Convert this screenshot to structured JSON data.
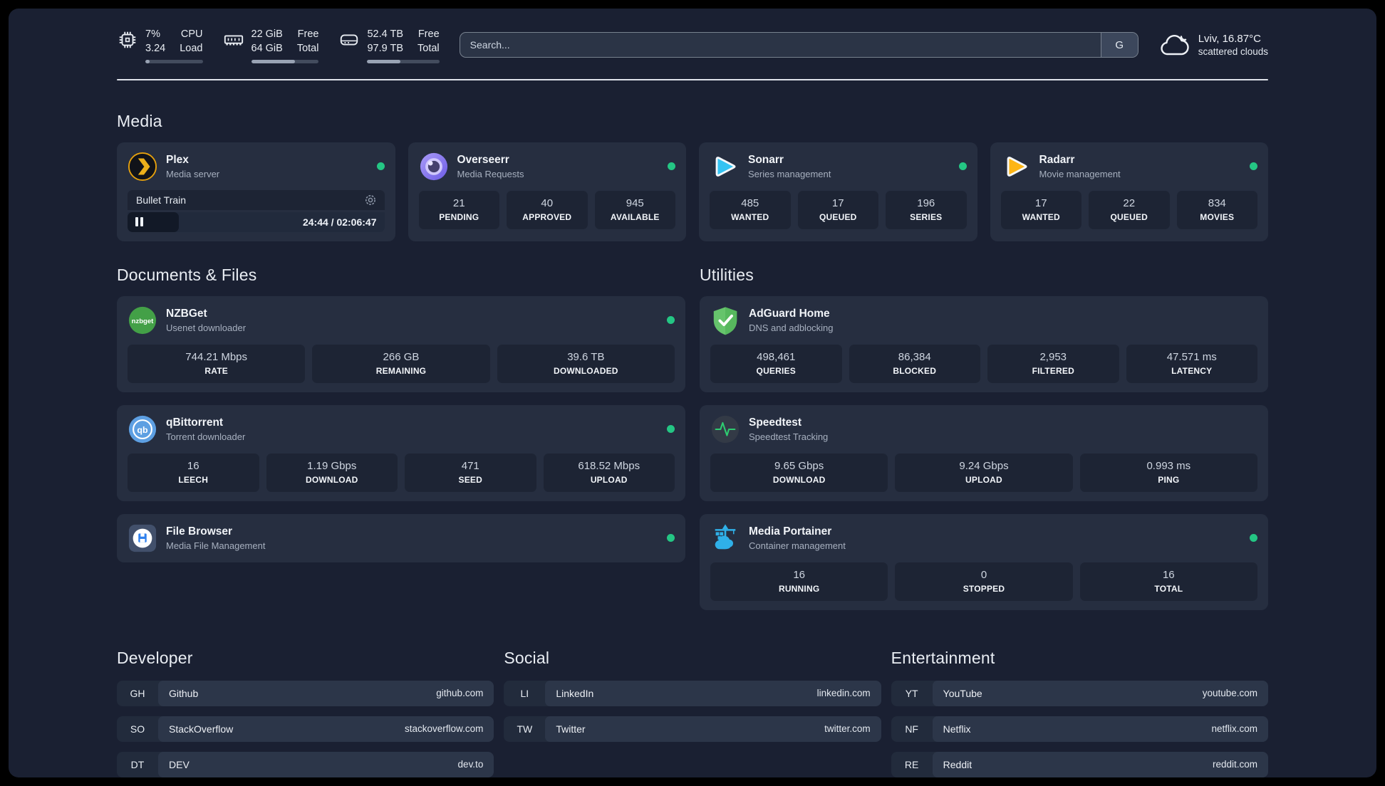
{
  "colors": {
    "status_online": "#24c684",
    "plex_accent": "#e5a00d",
    "progress_fill": "#99a3b4"
  },
  "header": {
    "cpu": {
      "value_top": "7%",
      "value_bottom": "3.24",
      "label_top": "CPU",
      "label_bottom": "Load",
      "progress_pct": 7
    },
    "ram": {
      "value_top": "22 GiB",
      "value_bottom": "64 GiB",
      "label_top": "Free",
      "label_bottom": "Total",
      "progress_pct": 65
    },
    "disk": {
      "value_top": "52.4 TB",
      "value_bottom": "97.9 TB",
      "label_top": "Free",
      "label_bottom": "Total",
      "progress_pct": 46
    },
    "search": {
      "placeholder": "Search...",
      "engine_button": "G"
    },
    "weather": {
      "location_temp": "Lviv, 16.87°C",
      "condition": "scattered clouds"
    }
  },
  "sections": {
    "media": {
      "title": "Media",
      "plex": {
        "name": "Plex",
        "subtitle": "Media server",
        "player": {
          "track": "Bullet Train",
          "time": "24:44 / 02:06:47",
          "progress_pct": 20
        }
      },
      "overseerr": {
        "name": "Overseerr",
        "subtitle": "Media Requests",
        "stats": [
          {
            "value": "21",
            "label": "PENDING"
          },
          {
            "value": "40",
            "label": "APPROVED"
          },
          {
            "value": "945",
            "label": "AVAILABLE"
          }
        ]
      },
      "sonarr": {
        "name": "Sonarr",
        "subtitle": "Series management",
        "stats": [
          {
            "value": "485",
            "label": "WANTED"
          },
          {
            "value": "17",
            "label": "QUEUED"
          },
          {
            "value": "196",
            "label": "SERIES"
          }
        ]
      },
      "radarr": {
        "name": "Radarr",
        "subtitle": "Movie management",
        "stats": [
          {
            "value": "17",
            "label": "WANTED"
          },
          {
            "value": "22",
            "label": "QUEUED"
          },
          {
            "value": "834",
            "label": "MOVIES"
          }
        ]
      }
    },
    "documents": {
      "title": "Documents & Files",
      "nzbget": {
        "name": "NZBGet",
        "subtitle": "Usenet downloader",
        "stats": [
          {
            "value": "744.21 Mbps",
            "label": "RATE"
          },
          {
            "value": "266 GB",
            "label": "REMAINING"
          },
          {
            "value": "39.6 TB",
            "label": "DOWNLOADED"
          }
        ]
      },
      "qbittorrent": {
        "name": "qBittorrent",
        "subtitle": "Torrent downloader",
        "stats": [
          {
            "value": "16",
            "label": "LEECH"
          },
          {
            "value": "1.19 Gbps",
            "label": "DOWNLOAD"
          },
          {
            "value": "471",
            "label": "SEED"
          },
          {
            "value": "618.52 Mbps",
            "label": "UPLOAD"
          }
        ]
      },
      "filebrowser": {
        "name": "File Browser",
        "subtitle": "Media File Management"
      }
    },
    "utilities": {
      "title": "Utilities",
      "adguard": {
        "name": "AdGuard Home",
        "subtitle": "DNS and adblocking",
        "stats": [
          {
            "value": "498,461",
            "label": "QUERIES"
          },
          {
            "value": "86,384",
            "label": "BLOCKED"
          },
          {
            "value": "2,953",
            "label": "FILTERED"
          },
          {
            "value": "47.571 ms",
            "label": "LATENCY"
          }
        ]
      },
      "speedtest": {
        "name": "Speedtest",
        "subtitle": "Speedtest Tracking",
        "stats": [
          {
            "value": "9.65 Gbps",
            "label": "DOWNLOAD"
          },
          {
            "value": "9.24 Gbps",
            "label": "UPLOAD"
          },
          {
            "value": "0.993 ms",
            "label": "PING"
          }
        ]
      },
      "portainer": {
        "name": "Media Portainer",
        "subtitle": "Container management",
        "stats": [
          {
            "value": "16",
            "label": "RUNNING"
          },
          {
            "value": "0",
            "label": "STOPPED"
          },
          {
            "value": "16",
            "label": "TOTAL"
          }
        ]
      }
    },
    "developer": {
      "title": "Developer",
      "links": [
        {
          "tag": "GH",
          "name": "Github",
          "url": "github.com"
        },
        {
          "tag": "SO",
          "name": "StackOverflow",
          "url": "stackoverflow.com"
        },
        {
          "tag": "DT",
          "name": "DEV",
          "url": "dev.to"
        }
      ]
    },
    "social": {
      "title": "Social",
      "links": [
        {
          "tag": "LI",
          "name": "LinkedIn",
          "url": "linkedin.com"
        },
        {
          "tag": "TW",
          "name": "Twitter",
          "url": "twitter.com"
        }
      ]
    },
    "entertainment": {
      "title": "Entertainment",
      "links": [
        {
          "tag": "YT",
          "name": "YouTube",
          "url": "youtube.com"
        },
        {
          "tag": "NF",
          "name": "Netflix",
          "url": "netflix.com"
        },
        {
          "tag": "RE",
          "name": "Reddit",
          "url": "reddit.com"
        }
      ]
    }
  }
}
